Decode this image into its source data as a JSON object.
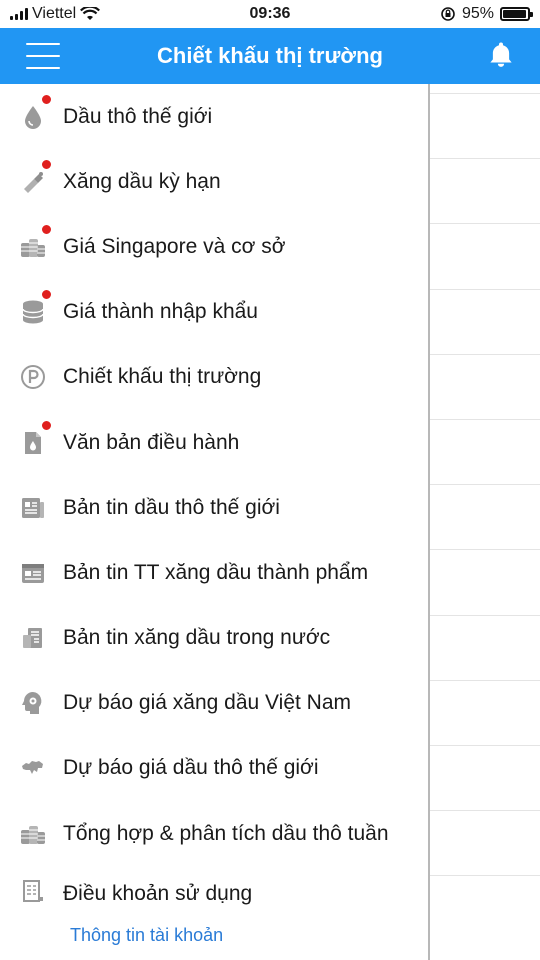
{
  "status_bar": {
    "carrier": "Viettel",
    "time": "09:36",
    "battery_percent_text": "95%",
    "battery_level": 0.95
  },
  "header": {
    "title": "Chiết khấu thị trường",
    "menu_icon": "hamburger-icon",
    "bell_icon": "bell-icon",
    "background": "#2196f3"
  },
  "menu": {
    "items": [
      {
        "label": "Dầu thô thế giới",
        "icon": "oil-drop-icon",
        "badge": true
      },
      {
        "label": "Xăng dầu kỳ hạn",
        "icon": "fuel-nozzle-icon",
        "badge": true
      },
      {
        "label": "Giá Singapore và cơ sở",
        "icon": "coin-stack-icon",
        "badge": true
      },
      {
        "label": "Giá thành nhập khẩu",
        "icon": "database-icon",
        "badge": true
      },
      {
        "label": "Chiết khấu thị trường",
        "icon": "parking-circle-icon",
        "badge": false
      },
      {
        "label": "Văn bản điều hành",
        "icon": "document-fire-icon",
        "badge": true
      },
      {
        "label": "Bản tin dầu thô thế giới",
        "icon": "newspaper-icon",
        "badge": false
      },
      {
        "label": "Bản tin TT xăng dầu thành phẩm",
        "icon": "calendar-news-icon",
        "badge": false
      },
      {
        "label": "Bản tin xăng dầu trong nước",
        "icon": "building-news-icon",
        "badge": false
      },
      {
        "label": "Dự báo giá xăng dầu Việt Nam",
        "icon": "head-gear-icon",
        "badge": false
      },
      {
        "label": "Dự báo giá dầu thô thế giới",
        "icon": "map-icon",
        "badge": false
      },
      {
        "label": "Tổng hợp & phân tích dầu thô tuần",
        "icon": "coin-stack-icon",
        "badge": false
      },
      {
        "label": "Điều khoản sử dụng",
        "icon": "terms-document-icon",
        "badge": false
      }
    ],
    "account_link": "Thông tin tài khoản"
  },
  "colors": {
    "accent": "#2196f3",
    "badge": "#e0201e",
    "link": "#2a7bd6",
    "icon_gray": "#9a9a9a"
  }
}
